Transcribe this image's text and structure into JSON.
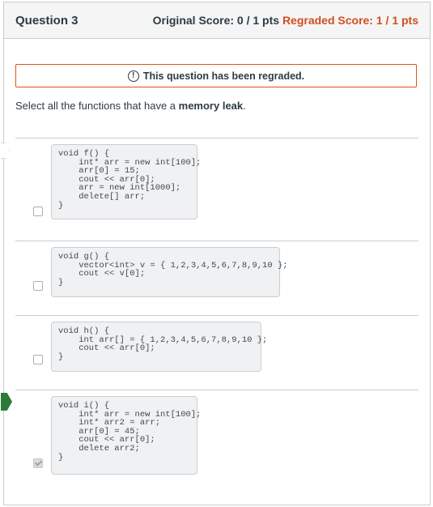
{
  "question": {
    "title": "Question 3",
    "original_score": "Original Score: 0 / 1 pts",
    "regraded_score": "Regraded Score: 1 / 1 pts"
  },
  "banner": {
    "icon": "alert-icon",
    "text": "This question has been regraded."
  },
  "prompt": {
    "text": "Select all the functions that have a ",
    "emphasis": "memory leak",
    "suffix": "."
  },
  "answers": [
    {
      "checked": false,
      "code": "void f() {\n    int* arr = new int[100];\n    arr[0] = 15;\n    cout << arr[0];\n    arr = new int[1000];\n    delete[] arr;\n}"
    },
    {
      "checked": false,
      "code": "void g() {\n    vector<int> v = { 1,2,3,4,5,6,7,8,9,10 };\n    cout << v[0];\n}"
    },
    {
      "checked": false,
      "code": "void h() {\n    int arr[] = { 1,2,3,4,5,6,7,8,9,10 };\n    cout << arr[0];\n}"
    },
    {
      "checked": true,
      "code": "void i() {\n    int* arr = new int[100];\n    int* arr2 = arr;\n    arr[0] = 45;\n    cout << arr[0];\n    delete arr2;\n}"
    }
  ],
  "colors": {
    "accent_orange": "#d04f1f",
    "correct_green": "#2b7a3a",
    "border": "#c7cdd1"
  }
}
